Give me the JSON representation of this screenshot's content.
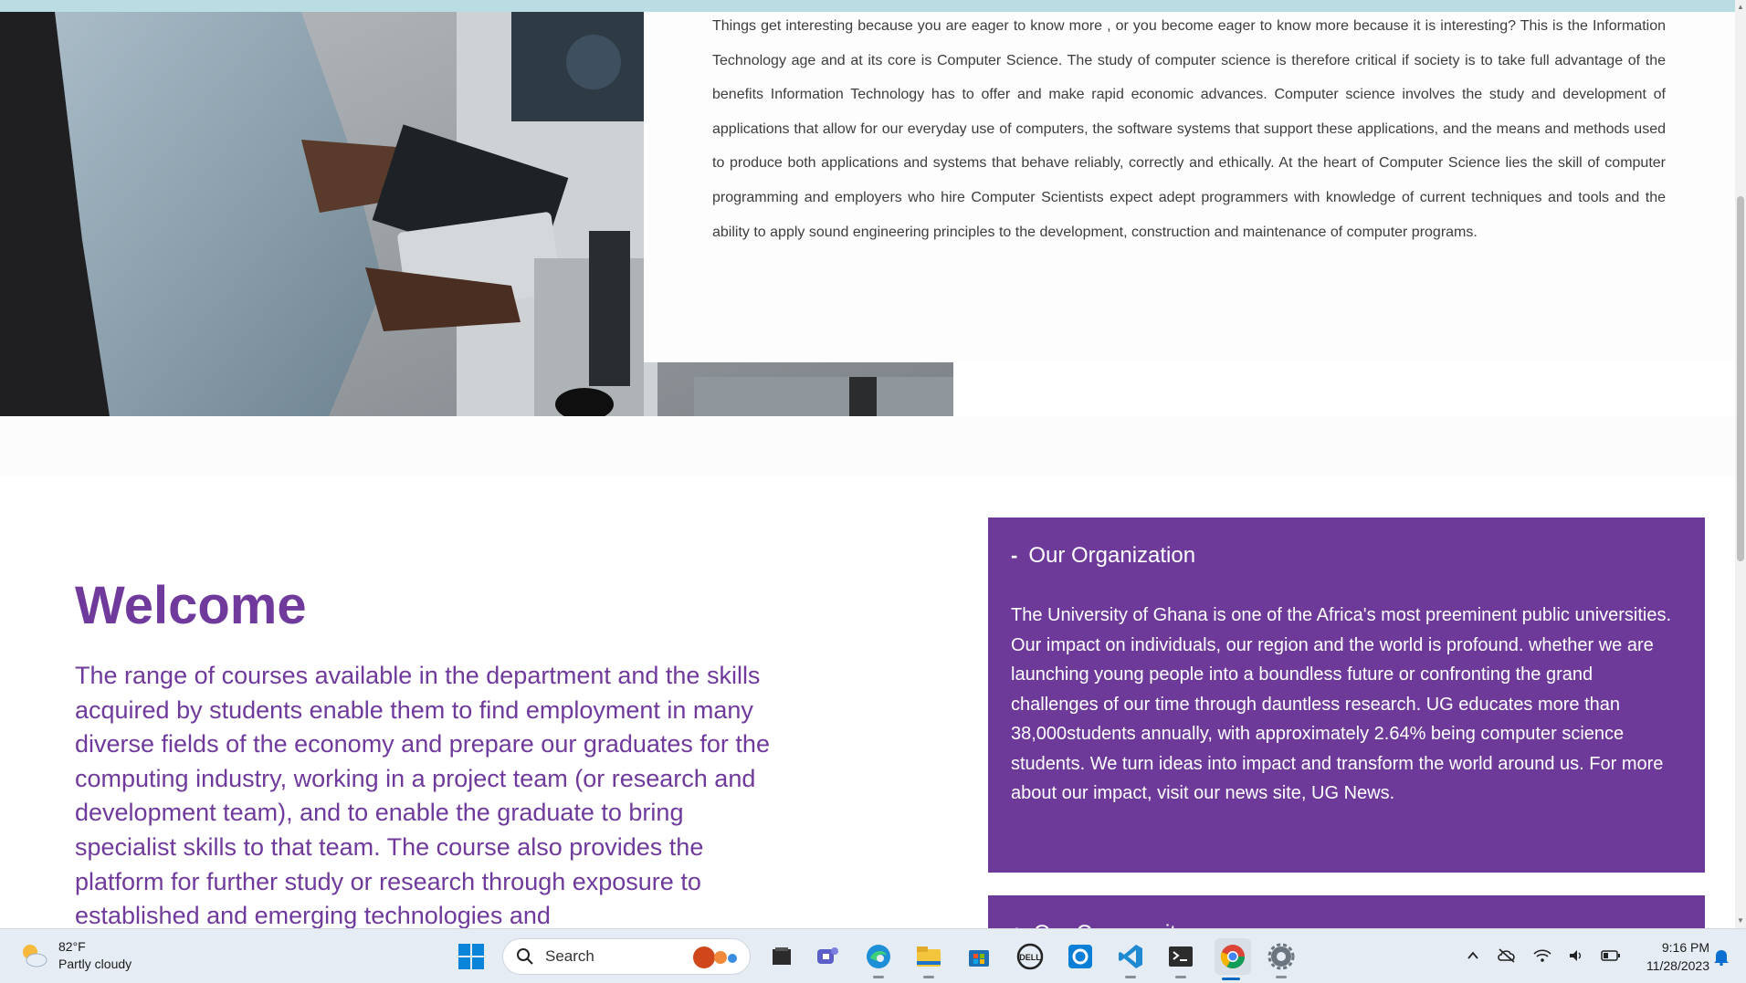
{
  "intro": {
    "paragraph": "Things get interesting because you are eager to know more , or you become eager to know more because it is interesting? This is the Information Technology age and at its core is Computer Science. The study of computer science is therefore critical if society is to take full advantage of the benefits Information Technology has to offer and make rapid economic advances. Computer science involves the study and development of applications that allow for our everyday use of computers, the software systems that support these applications, and the means and methods used to produce both applications and systems that behave reliably, correctly and ethically. At the heart of Computer Science lies the skill of computer programming and employers who hire Computer Scientists expect adept programmers with knowledge of current techniques and tools and the ability to apply sound engineering principles to the development, construction and maintenance of computer programs."
  },
  "welcome": {
    "title": "Welcome",
    "body": "The range of courses available in the department and the skills acquired by students enable them to find employment in many diverse fields of the economy and prepare our graduates for the computing industry, working in a project team (or research and development team), and to enable the graduate to bring specialist skills to that team. The course also provides the platform for further study or research through exposure to established and emerging technologies and"
  },
  "panels": {
    "organization": {
      "toggle": "-",
      "title": "Our Organization",
      "body": "The University of Ghana is one of the Africa's most preeminent public universities. Our impact on individuals, our region and the world is profound. whether we are launching young people into a boundless future or confronting the grand challenges of our time through dauntless research. UG educates more than 38,000students annually, with approximately 2.64% being computer science students. We turn ideas into impact and transform the world around us. For more about our impact, visit our news site, UG News."
    },
    "community": {
      "toggle": "+",
      "title": "Our Community"
    }
  },
  "taskbar": {
    "weather": {
      "temp": "82°F",
      "condition": "Partly cloudy"
    },
    "search": {
      "placeholder": "Search"
    },
    "pinned": [
      "file-explorer-dark-icon",
      "teams-icon",
      "edge-icon",
      "file-explorer-icon",
      "store-icon",
      "dell-icon",
      "cortana-icon",
      "vscode-icon",
      "terminal-icon",
      "chrome-icon",
      "settings-icon"
    ],
    "clock": {
      "time": "9:16 PM",
      "date": "11/28/2023"
    }
  },
  "colors": {
    "accent_purple": "#6e3a9a",
    "welcome_text": "#6f3a9c",
    "taskbar_bg": "#e6ecf3"
  }
}
